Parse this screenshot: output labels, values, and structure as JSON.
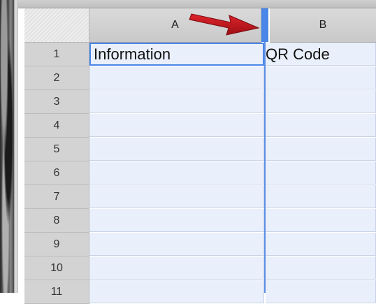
{
  "columns": [
    {
      "id": "A",
      "label": "A"
    },
    {
      "id": "B",
      "label": "B"
    }
  ],
  "rows": [
    {
      "number": "1",
      "a": "Information",
      "b": "QR Code"
    },
    {
      "number": "2",
      "a": "",
      "b": ""
    },
    {
      "number": "3",
      "a": "",
      "b": ""
    },
    {
      "number": "4",
      "a": "",
      "b": ""
    },
    {
      "number": "5",
      "a": "",
      "b": ""
    },
    {
      "number": "6",
      "a": "",
      "b": ""
    },
    {
      "number": "7",
      "a": "",
      "b": ""
    },
    {
      "number": "8",
      "a": "",
      "b": ""
    },
    {
      "number": "9",
      "a": "",
      "b": ""
    },
    {
      "number": "10",
      "a": "",
      "b": ""
    },
    {
      "number": "11",
      "a": "",
      "b": ""
    }
  ],
  "selected_cell": "A1",
  "colors": {
    "selection": "#4a86e8",
    "cell_fill": "#eaf0fb",
    "annotation_arrow": "#c0141c"
  },
  "annotation": {
    "icon": "red-arrow-icon"
  }
}
